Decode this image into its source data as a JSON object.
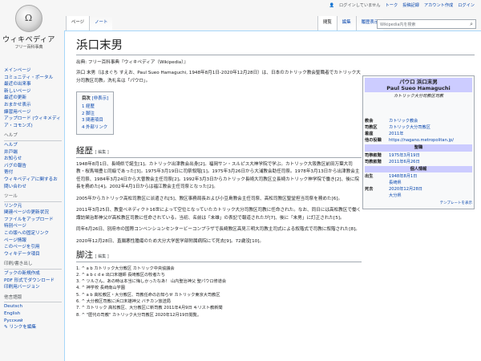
{
  "logo": {
    "wordmark": "ウィキペディア",
    "tagline": "フリー百科事典",
    "glyph": "Ω"
  },
  "sidebar": {
    "nav": [
      "メインページ",
      "コミュニティ・ポータル",
      "最近の出来事",
      "新しいページ",
      "最近の更新",
      "おまかせ表示",
      "練習用ページ",
      "アップロード (ウィキメディア・コモンズ)"
    ],
    "help_head": "ヘルプ",
    "help": [
      "ヘルプ",
      "井戸端",
      "お知らせ",
      "バグの報告",
      "寄付",
      "ウィキペディアに関するお問い合わせ"
    ],
    "tools_head": "ツール",
    "tools": [
      "リンク元",
      "関連ページの更新状況",
      "ファイルをアップロード",
      "特別ページ",
      "この版への固定リンク",
      "ページ情報",
      "このページを引用",
      "ウィキデータ項目"
    ],
    "print_head": "印刷/書き出し",
    "print": [
      "ブックの新規作成",
      "PDF 形式でダウンロード",
      "印刷用バージョン"
    ],
    "lang_head": "他言語版",
    "langs": [
      "Deutsch",
      "English",
      "Русский"
    ],
    "lang_edit": "リンクを編集"
  },
  "personal": {
    "notlogged": "ログインしていません",
    "talk": "トーク",
    "contrib": "投稿記録",
    "create": "アカウント作成",
    "login": "ログイン"
  },
  "tabs": {
    "page": "ページ",
    "note": "ノート",
    "read": "閲覧",
    "edit": "編集",
    "history": "履歴表示"
  },
  "search": {
    "placeholder": "Wikipedia内を検索"
  },
  "article": {
    "title": "浜口末男",
    "from": "出典: フリー百科事典『ウィキペディア（Wikipedia）』",
    "lead": "浜口 末男（はまぐち すえお、Paul Sueo Hamaguchi, 1948年8月1日-2020年12月28日）は、日本のカトリック教会聖職者でカトリック大分司教区司教。洗礼名は「パウロ」。",
    "toc_title": "目次",
    "toc_hide": "[非表示]",
    "toc": [
      "1 経歴",
      "2 脚注",
      "3 関連項目",
      "4 外部リンク"
    ],
    "h_career": "経歴",
    "edit": "[ 編集 ]",
    "p1": "1948年8月1日、長崎県で誕生[1]。カトリック出津教会出身[2]。福岡サン・スルピス大神学院で学ぶ。カトリック大阪教区前田万葉大司教・桜馬場豊と同級であった[3]。1975年3月19日に司祭叙階[1]。1975年3月26日から大浦教会助任司祭。1978年3月13日から出津教会主任司祭、1984年3月24日から大曽教会主任司祭[2]。1992年3月3日からカトリック長崎大司教区立長崎カトリック神学院で働き[2]、後に院長を務めた[4]。2002年4月1日からは福江教会主任司祭となった[2]。",
    "p2": "2005年からカトリック高松司教区に派遣され[5]、教区事務局長および小豆島教会主任司祭、高松司教区聖堂担当司祭を務めた[6]。",
    "p3": "2011年3月25日、教皇ベネディクト16世によって空位となっていたカトリック大分司教区司教に任命された。なお、同日には高松教区で働く諏訪榮治郎神父が高松教区司教に任命されている。当初、名前は「末雄」の表記で報道されたが[7]、後に「末男」に訂正された[5]。",
    "p4": "同年6月26日、別府市の国際コンベンションセンタービーコンプラザで長崎教区高見三明大司教主司式による叙階式で司教に叙階された[8]。",
    "p5": "2020年12月28日、直腸悪性腫瘍のため大分大学医学部附属病院にて死去[9]。72歳没[10]。",
    "h_notes": "脚注",
    "refs": [
      "1. ^ a b カトリック大分教区 カトリック中央協議会",
      "2. ^ a b c d e 出口末雄師 長崎教区の牧者たち",
      "3. ^ ツルさん、あの時は本当に悔しかったなあ！ 山内聖治神父 聖パウロ修道会",
      "4. ^ 神学校 長崎南山学園",
      "5. ^ a b 高松教区・大分教区、司教任命のお知らせ カトリック東京大司教区",
      "6. ^ 大分教区司教に浜口末雄神父 バチカン放送局",
      "7. ^ カトリック 高松教区、大分教区に新司教 2011年4月9日 キリスト教新聞",
      "8. ^ \"歴代の司教\" カトリック大分司教区 2020年12月19日閲覧。"
    ]
  },
  "infobox": {
    "title": "パウロ 浜口末男",
    "title_en": "Paul Sueo Hamaguchi",
    "subtitle": "カトリック大分司教区司教",
    "rows1": [
      [
        "教会",
        "カトリック教会"
      ],
      [
        "司教区",
        "カトリック大分司教区"
      ],
      [
        "着座",
        "2011年"
      ],
      [
        "他の役職",
        "https://nagano.metropolitan.jp/"
      ]
    ],
    "sec_ord": "聖職",
    "rows2": [
      [
        "司祭叙階",
        "1975年3月19日"
      ],
      [
        "司教叙階",
        "2011年6月26日"
      ]
    ],
    "sec_pers": "個人情報",
    "rows3": [
      [
        "出生",
        "1948年8月1日"
      ],
      [
        "",
        "長崎県"
      ],
      [
        "死去",
        "2020年12月28日"
      ],
      [
        "",
        "大分県"
      ]
    ],
    "template": "テンプレートを表示"
  }
}
